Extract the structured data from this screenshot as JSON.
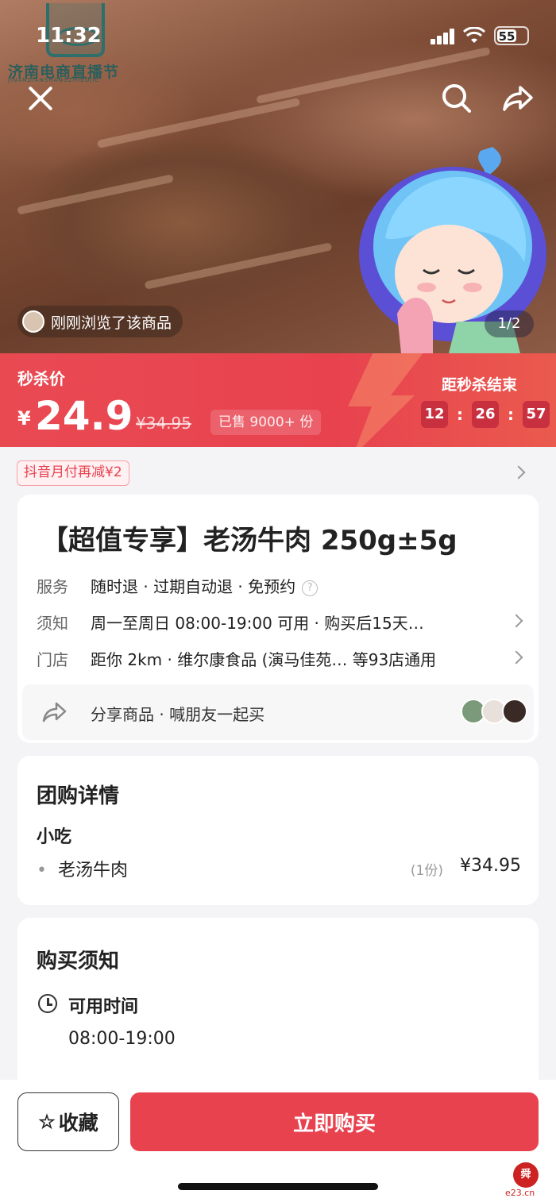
{
  "status_bar": {
    "time": "11:32",
    "battery": "55"
  },
  "logo": {
    "text": "济南电商直播节",
    "subtext": "JINANDIANSHANGZHIBOJIE"
  },
  "hero": {
    "recent_view": "刚刚浏览了该商品",
    "page_indicator": "1/2"
  },
  "flash_sale": {
    "label": "秒杀价",
    "currency": "¥",
    "price": "24.9",
    "original_price": "¥34.95",
    "sold": "已售 9000+ 份",
    "countdown_label": "距秒杀结束",
    "countdown": {
      "hours": "12",
      "minutes": "26",
      "seconds": "57",
      "separator": ":"
    }
  },
  "promo": {
    "tag": "抖音月付再减¥2"
  },
  "product": {
    "title": "【超值专享】老汤牛肉 250g±5g",
    "rows": [
      {
        "key": "服务",
        "value": "随时退 · 过期自动退 · 免预约"
      },
      {
        "key": "须知",
        "value": "周一至周日 08:00-19:00 可用 · 购买后15天…"
      },
      {
        "key": "门店",
        "value": "距你 2km · 维尔康食品 (演马佳苑… 等93店通用"
      }
    ],
    "share_text": "分享商品 · 喊朋友一起买"
  },
  "group_detail": {
    "heading": "团购详情",
    "category": "小吃",
    "items": [
      {
        "name": "老汤牛肉",
        "qty": "(1份)",
        "price": "¥34.95"
      }
    ]
  },
  "purchase_notes": {
    "heading": "购买须知",
    "section": "可用时间",
    "hours": "08:00-19:00"
  },
  "actions": {
    "favorite": "收藏",
    "buy": "立即购买"
  },
  "watermark": {
    "seal": "舜",
    "url": "e23.cn"
  },
  "colors": {
    "accent": "#e8424f",
    "accent_dark": "#c9303f",
    "promo_bg": "#fff0f1"
  },
  "icons": [
    "close-icon",
    "search-icon",
    "share-icon",
    "question-icon",
    "chevron-right-icon",
    "clock-icon",
    "star-icon"
  ]
}
